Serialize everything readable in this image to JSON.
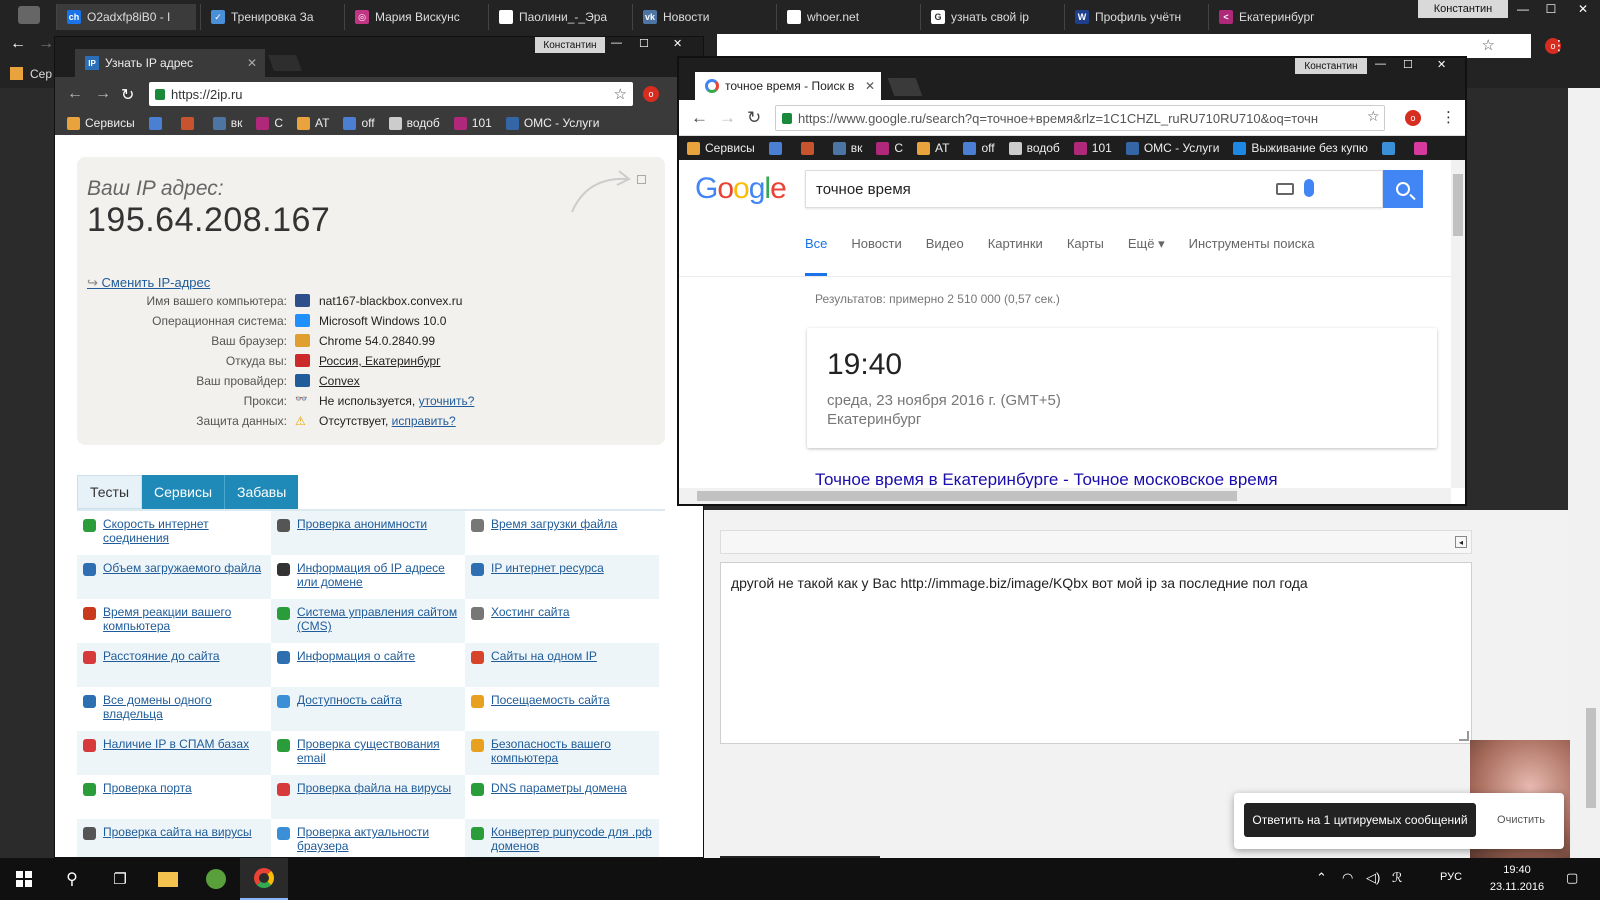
{
  "main_window": {
    "tabs": [
      {
        "label": "O2adxfp8iB0 - I",
        "color": "#1a73e8",
        "glyph": "ch"
      },
      {
        "label": "Тренировка За",
        "color": "#4a90d9",
        "glyph": "✓"
      },
      {
        "label": "Мария Вискунc",
        "color": "#c13584",
        "glyph": "◎"
      },
      {
        "label": "Паолини_-_Эра",
        "color": "#ffffff",
        "glyph": ""
      },
      {
        "label": "Новости",
        "color": "#4c75a3",
        "glyph": "vk"
      },
      {
        "label": "whoer.net",
        "color": "#ffffff",
        "glyph": ""
      },
      {
        "label": "узнать свой ip",
        "color": "#ffffff",
        "glyph": "G"
      },
      {
        "label": "Профиль учётн",
        "color": "#1e3f8c",
        "glyph": "W"
      },
      {
        "label": "Екатеринбург",
        "color": "#b0287a",
        "glyph": "<"
      }
    ],
    "user": "Константин",
    "bookmarks_partial": "Сер"
  },
  "ip_window": {
    "user": "Константин",
    "tab_title": "Узнать IP адрес",
    "url": "https://2ip.ru",
    "bookmarks": [
      {
        "label": "Сервисы",
        "color": "#e8a33c"
      },
      {
        "label": "",
        "color": "#4a7fd4"
      },
      {
        "label": "",
        "color": "#c8542f"
      },
      {
        "label": "вк",
        "color": "#4c75a3"
      },
      {
        "label": "С",
        "color": "#b0287a"
      },
      {
        "label": "AT",
        "color": "#e8a33c"
      },
      {
        "label": "off",
        "color": "#4a7fd4"
      },
      {
        "label": "водоб",
        "color": "#cccccc"
      },
      {
        "label": "101",
        "color": "#b0287a"
      },
      {
        "label": "ОМС - Услуги",
        "color": "#3465a4"
      }
    ],
    "more_bookmarks": "»",
    "ip_label": "Ваш IP адрес:",
    "ip_value": "195.64.208.167",
    "change_ip": "Сменить IP-адрес",
    "info": [
      {
        "key": "Имя вашего компьютера:",
        "value": "nat167-blackbox.convex.ru",
        "icon": "#2d4f8a",
        "link": false
      },
      {
        "key": "Операционная система:",
        "value": "Microsoft Windows 10.0",
        "icon": "#1e90ff",
        "link": false
      },
      {
        "key": "Ваш браузер:",
        "value": "Chrome 54.0.2840.99",
        "icon": "#e0a030",
        "link": false
      },
      {
        "key": "Откуда вы:",
        "value": "Россия, Екатеринбург",
        "icon": "#cc2a2a",
        "link": true
      },
      {
        "key": "Ваш провайдер:",
        "value": "Convex",
        "icon": "#1f5c99",
        "link": true
      }
    ],
    "proxy": {
      "key": "Прокси:",
      "value": "Не используется,",
      "link": "уточнить?"
    },
    "protection": {
      "key": "Защита данных:",
      "value": "Отсутствует,",
      "link": "исправить?"
    },
    "service_tabs": [
      "Тесты",
      "Сервисы",
      "Забавы"
    ],
    "services": [
      [
        "Скорость интернет соединения",
        "Проверка анонимности",
        "Время загрузки файла"
      ],
      [
        "Объем загружаемого файла",
        "Информация об IP адресе или домене",
        "IP интернет ресурса"
      ],
      [
        "Время реакции вашего компьютера",
        "Система управления сайтом (CMS)",
        "Хостинг сайта"
      ],
      [
        "Расстояние до сайта",
        "Информация о сайте",
        "Сайты на одном IP"
      ],
      [
        "Все домены одного владельца",
        "Доступность сайта",
        "Посещаемость сайта"
      ],
      [
        "Наличие IP в СПАМ базах",
        "Проверка существования email",
        "Безопасность вашего компьютера"
      ],
      [
        "Проверка порта",
        "Проверка файла на вирусы",
        "DNS параметры домена"
      ],
      [
        "Проверка сайта на вирусы",
        "Проверка актуальности браузера",
        "Конвертер punycode для .рф доменов"
      ]
    ],
    "service_icon_colors": [
      "#2a9d3a",
      "#555555",
      "#777777",
      "#2d6fb0",
      "#333333",
      "#2d6fb0",
      "#c83a1e",
      "#2a9d3a",
      "#777777",
      "#d63a3a",
      "#2d6fb0",
      "#d6452a",
      "#2d6fb0",
      "#3a8fd6",
      "#e8a020",
      "#d63a3a",
      "#2a9d3a",
      "#e8a020",
      "#2a9d3a",
      "#d63a3a",
      "#2a9d3a",
      "#555555",
      "#3a8fd6",
      "#2a9d3a"
    ]
  },
  "google_window": {
    "user": "Константин",
    "tab_title": "точное время - Поиск в",
    "url": "https://www.google.ru/search?q=точное+время&rlz=1C1CHZL_ruRU710RU710&oq=точн",
    "bookmarks": [
      "Сервисы",
      "",
      "",
      "вк",
      "С",
      "AT",
      "off",
      "водоб",
      "101",
      "ОМС - Услуги",
      "Выживание без купю",
      "",
      ""
    ],
    "logo": [
      "G",
      "o",
      "o",
      "g",
      "l",
      "e"
    ],
    "query": "точное время",
    "nav": [
      "Все",
      "Новости",
      "Видео",
      "Картинки",
      "Карты",
      "Ещё ▾",
      "Инструменты поиска"
    ],
    "results_count": "Результатов: примерно 2 510 000 (0,57 сек.)",
    "time": "19:40",
    "date": "среда, 23 ноября 2016 г. (GMT+5)",
    "city": "Екатеринбург",
    "first_result": "Точное время в Екатеринбурге - Точное московское время"
  },
  "forum": {
    "editor_text": "другой не такой как у Вас http://immage.biz/image/KQbx вот мой ip за последние пол года",
    "quote_button": "Ответить на 1 цитируемых сообщений",
    "clear_button": "Очистить"
  },
  "taskbar": {
    "lang": "РУС",
    "time": "19:40",
    "date": "23.11.2016"
  }
}
